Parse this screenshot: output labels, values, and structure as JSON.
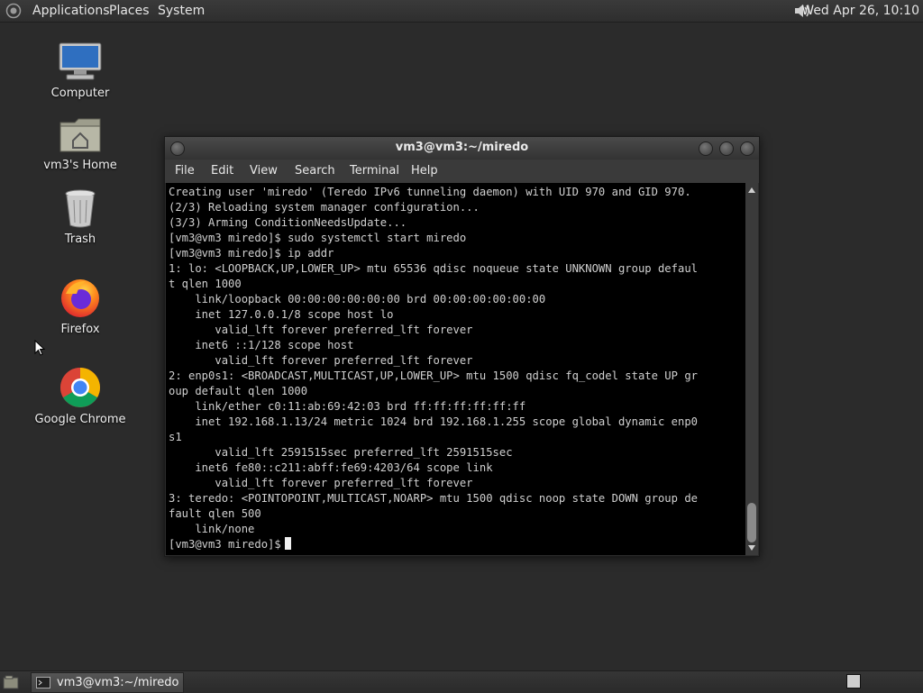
{
  "top_panel": {
    "menus": [
      "Applications",
      "Places",
      "System"
    ],
    "clock": "Wed Apr 26, 10:10"
  },
  "desktop_icons": [
    {
      "label": "Computer",
      "icon": "computer-icon"
    },
    {
      "label": "vm3's Home",
      "icon": "home-folder-icon"
    },
    {
      "label": "Trash",
      "icon": "trash-icon"
    },
    {
      "label": "Firefox",
      "icon": "firefox-icon"
    },
    {
      "label": "Google Chrome",
      "icon": "chrome-icon"
    }
  ],
  "terminal": {
    "title": "vm3@vm3:~/miredo",
    "menus": [
      "File",
      "Edit",
      "View",
      "Search",
      "Terminal",
      "Help"
    ],
    "lines": [
      "Creating user 'miredo' (Teredo IPv6 tunneling daemon) with UID 970 and GID 970.",
      "(2/3) Reloading system manager configuration...",
      "(3/3) Arming ConditionNeedsUpdate...",
      "[vm3@vm3 miredo]$ sudo systemctl start miredo",
      "[vm3@vm3 miredo]$ ip addr",
      "1: lo: <LOOPBACK,UP,LOWER_UP> mtu 65536 qdisc noqueue state UNKNOWN group defaul",
      "t qlen 1000",
      "    link/loopback 00:00:00:00:00:00 brd 00:00:00:00:00:00",
      "    inet 127.0.0.1/8 scope host lo",
      "       valid_lft forever preferred_lft forever",
      "    inet6 ::1/128 scope host",
      "       valid_lft forever preferred_lft forever",
      "2: enp0s1: <BROADCAST,MULTICAST,UP,LOWER_UP> mtu 1500 qdisc fq_codel state UP gr",
      "oup default qlen 1000",
      "    link/ether c0:11:ab:69:42:03 brd ff:ff:ff:ff:ff:ff",
      "    inet 192.168.1.13/24 metric 1024 brd 192.168.1.255 scope global dynamic enp0",
      "s1",
      "       valid_lft 2591515sec preferred_lft 2591515sec",
      "    inet6 fe80::c211:abff:fe69:4203/64 scope link",
      "       valid_lft forever preferred_lft forever",
      "3: teredo: <POINTOPOINT,MULTICAST,NOARP> mtu 1500 qdisc noop state DOWN group de",
      "fault qlen 500",
      "    link/none"
    ],
    "prompt": "[vm3@vm3 miredo]$"
  },
  "taskbar": {
    "task_label": "vm3@vm3:~/miredo"
  },
  "colors": {
    "desktop_bg": "#2b2b2b",
    "terminal_bg": "#000000",
    "terminal_fg": "#d0d0d0"
  }
}
